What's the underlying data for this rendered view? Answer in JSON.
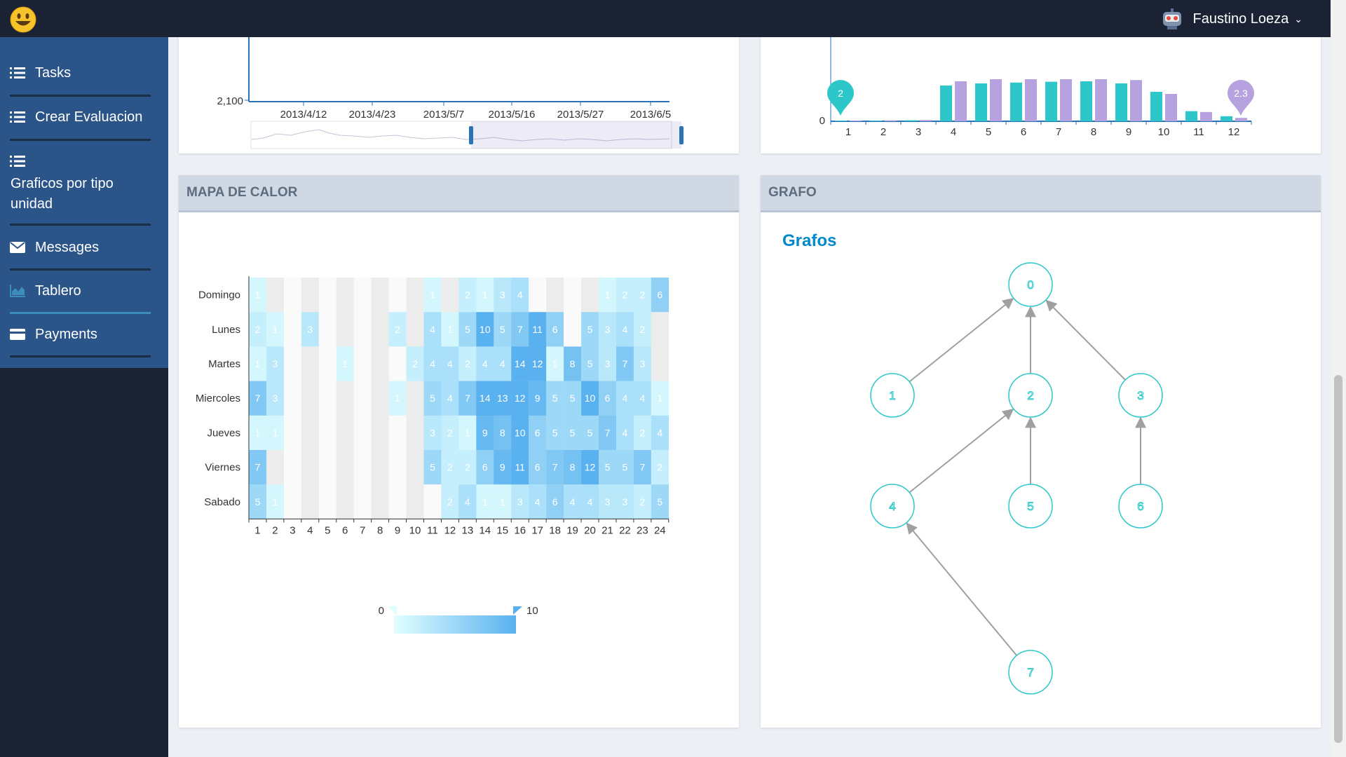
{
  "app": {
    "user_name": "Faustino Loeza"
  },
  "sidebar": {
    "items": [
      {
        "label": "Tasks",
        "icon": "list-icon"
      },
      {
        "label": "Crear Evaluacion",
        "icon": "list-icon"
      },
      {
        "label": "Graficos por tipo unidad",
        "icon": "list-icon"
      },
      {
        "label": "Messages",
        "icon": "envelope-icon"
      },
      {
        "label": "Tablero",
        "icon": "area-chart-icon",
        "active": true
      },
      {
        "label": "Payments",
        "icon": "credit-card-icon"
      }
    ]
  },
  "line_chart": {
    "y_tick": "2,100",
    "x_ticks": [
      "2013/4/12",
      "2013/4/23",
      "2013/5/7",
      "2013/5/16",
      "2013/5/27",
      "2013/6/5"
    ]
  },
  "chart_data": [
    {
      "type": "bar",
      "categories": [
        "1",
        "2",
        "3",
        "4",
        "5",
        "6",
        "7",
        "8",
        "9",
        "10",
        "11",
        "12"
      ],
      "y_tick_visible": "0",
      "series": [
        {
          "color": "#2ec7c9",
          "values": [
            0.4,
            1.7,
            2.4,
            85,
            90,
            92,
            94,
            95,
            90,
            70,
            24,
            12
          ]
        },
        {
          "color": "#b6a2de",
          "values": [
            0.9,
            2.3,
            3.0,
            95,
            100,
            100,
            100,
            100,
            98,
            65,
            22,
            8
          ]
        }
      ],
      "mark_points": [
        {
          "category": "1",
          "series": 0,
          "label": "2"
        },
        {
          "category": "12",
          "series": 1,
          "label": "2.3"
        }
      ]
    },
    {
      "type": "heatmap",
      "title": "MAPA DE CALOR",
      "x": [
        "1",
        "2",
        "3",
        "4",
        "5",
        "6",
        "7",
        "8",
        "9",
        "10",
        "11",
        "12",
        "13",
        "14",
        "15",
        "16",
        "17",
        "18",
        "19",
        "20",
        "21",
        "22",
        "23",
        "24"
      ],
      "y": [
        "Domingo",
        "Lunes",
        "Martes",
        "Miercoles",
        "Jueves",
        "Viernes",
        "Sabado"
      ],
      "values": [
        [
          1,
          0,
          0,
          0,
          0,
          0,
          0,
          0,
          0,
          0,
          1,
          0,
          2,
          1,
          3,
          4,
          0,
          0,
          0,
          0,
          1,
          2,
          2,
          6
        ],
        [
          2,
          1,
          0,
          3,
          0,
          0,
          0,
          0,
          2,
          0,
          4,
          1,
          5,
          10,
          5,
          7,
          11,
          6,
          0,
          5,
          3,
          4,
          2,
          0
        ],
        [
          1,
          3,
          0,
          0,
          0,
          1,
          0,
          0,
          0,
          2,
          4,
          4,
          2,
          4,
          4,
          14,
          12,
          1,
          8,
          5,
          3,
          7,
          3,
          0
        ],
        [
          7,
          3,
          0,
          0,
          0,
          0,
          0,
          0,
          1,
          0,
          5,
          4,
          7,
          14,
          13,
          12,
          9,
          5,
          5,
          10,
          6,
          4,
          4,
          1
        ],
        [
          1,
          1,
          0,
          0,
          0,
          0,
          0,
          0,
          0,
          0,
          3,
          2,
          1,
          9,
          8,
          10,
          6,
          5,
          5,
          5,
          7,
          4,
          2,
          4
        ],
        [
          7,
          0,
          0,
          0,
          0,
          0,
          0,
          0,
          0,
          0,
          5,
          2,
          2,
          6,
          9,
          11,
          6,
          7,
          8,
          12,
          5,
          5,
          7,
          2
        ],
        [
          5,
          1,
          0,
          0,
          0,
          0,
          0,
          0,
          0,
          0,
          0,
          2,
          4,
          1,
          1,
          3,
          4,
          6,
          4,
          4,
          3,
          3,
          2,
          5
        ]
      ],
      "visual_map": {
        "min": "0",
        "max": "10"
      }
    },
    {
      "type": "graph",
      "title": "GRAFO",
      "subtitle": "Grafos",
      "nodes": [
        "0",
        "1",
        "2",
        "3",
        "4",
        "5",
        "6",
        "7"
      ],
      "edges": [
        [
          "1",
          "0"
        ],
        [
          "2",
          "0"
        ],
        [
          "3",
          "0"
        ],
        [
          "4",
          "2"
        ],
        [
          "5",
          "2"
        ],
        [
          "6",
          "3"
        ],
        [
          "7",
          "4"
        ]
      ]
    }
  ]
}
